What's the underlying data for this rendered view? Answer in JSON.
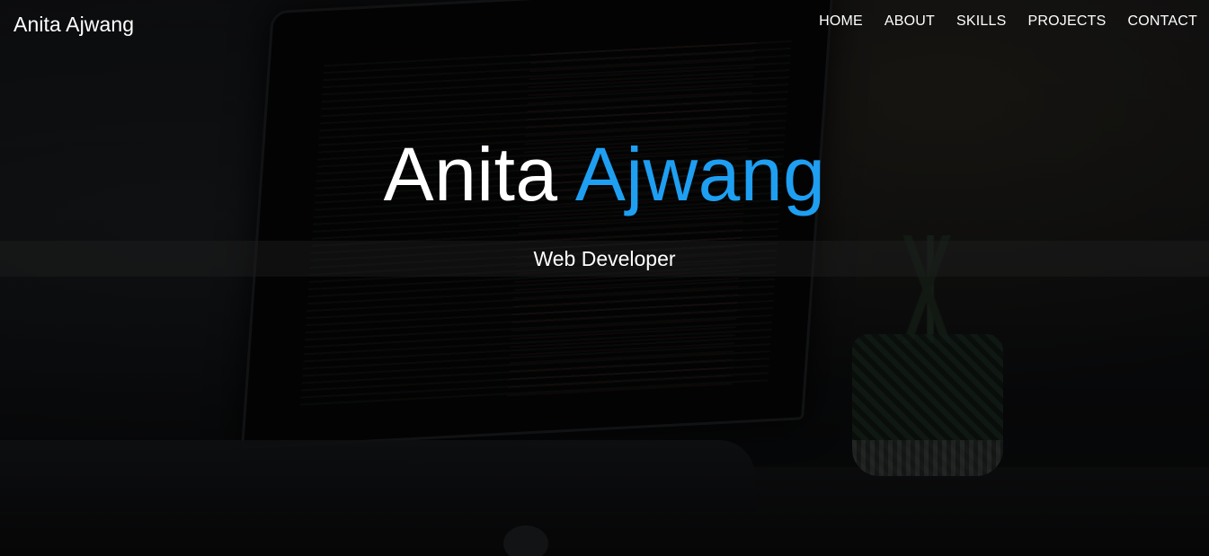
{
  "header": {
    "brand": "Anita Ajwang",
    "nav": [
      {
        "label": "HOME"
      },
      {
        "label": "ABOUT"
      },
      {
        "label": "SKILLS"
      },
      {
        "label": "PROJECTS"
      },
      {
        "label": "CONTACT"
      }
    ]
  },
  "hero": {
    "title_first": "Anita",
    "title_last": "Ajwang",
    "subtitle": "Web Developer"
  },
  "colors": {
    "accent": "#1e9ff2",
    "text": "#ffffff",
    "background": "#0b0c0e"
  }
}
